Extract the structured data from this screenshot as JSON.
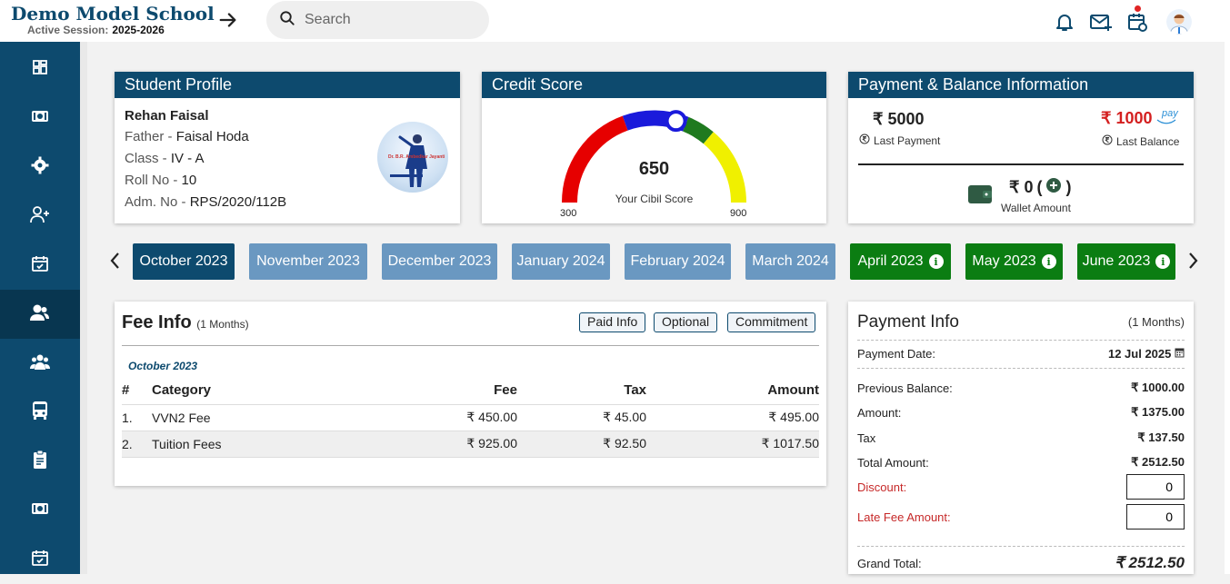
{
  "header": {
    "school_name": "Demo Model School",
    "session_label": "Active Session:",
    "session_value": "2025-2026",
    "search_placeholder": "Search"
  },
  "sidebar": {
    "items": [
      {
        "icon": "dashboard-icon"
      },
      {
        "icon": "money-icon"
      },
      {
        "icon": "settings-icon"
      },
      {
        "icon": "add-user-icon"
      },
      {
        "icon": "calendar-check-icon"
      },
      {
        "icon": "users-icon",
        "active": true
      },
      {
        "icon": "group-icon"
      },
      {
        "icon": "bus-icon"
      },
      {
        "icon": "clipboard-icon"
      },
      {
        "icon": "money-icon"
      },
      {
        "icon": "calendar-icon"
      }
    ]
  },
  "profile": {
    "title": "Student Profile",
    "name": "Rehan Faisal",
    "father_label": "Father - ",
    "father": "Faisal Hoda",
    "class_label": "Class - ",
    "class": "IV - A",
    "roll_label": "Roll No - ",
    "roll": "10",
    "adm_label": "Adm. No - ",
    "adm": "RPS/2020/112B",
    "photo_text": "Dr. B.R. Ambedkar Jayanti"
  },
  "credit": {
    "title": "Credit Score",
    "score": "650",
    "score_label": "Your Cibil Score",
    "min": "300",
    "max": "900",
    "score_value": 650,
    "range": [
      300,
      900
    ],
    "segment_colors": [
      "#e60000",
      "#1a1adb",
      "#1f7a1f",
      "#f0f000"
    ]
  },
  "payment_balance": {
    "title": "Payment & Balance Information",
    "last_payment": "₹ 5000",
    "last_payment_label": "Last Payment",
    "last_balance": "₹ 1000",
    "last_balance_label": "Last Balance",
    "pay_logo": "pay",
    "wallet_amount": "₹ 0",
    "wallet_label": "Wallet Amount"
  },
  "months": [
    {
      "label": "October 2023",
      "state": "selected"
    },
    {
      "label": "November 2023",
      "state": "unpaid"
    },
    {
      "label": "December 2023",
      "state": "unpaid"
    },
    {
      "label": "January 2024",
      "state": "unpaid"
    },
    {
      "label": "February 2024",
      "state": "unpaid"
    },
    {
      "label": "March 2024",
      "state": "unpaid"
    },
    {
      "label": "April 2023",
      "state": "paid"
    },
    {
      "label": "May 2023",
      "state": "paid"
    },
    {
      "label": "June 2023",
      "state": "paid"
    }
  ],
  "fee_info": {
    "title": "Fee Info",
    "months_note": "(1 Months)",
    "buttons": {
      "paid": "Paid Info",
      "optional": "Optional",
      "commitment": "Commitment"
    },
    "month_label": "October 2023",
    "columns": [
      "#",
      "Category",
      "Fee",
      "Tax",
      "Amount"
    ],
    "rows": [
      [
        "1.",
        "VVN2 Fee",
        "₹ 450.00",
        "₹ 45.00",
        "₹ 495.00"
      ],
      [
        "2.",
        "Tuition Fees",
        "₹ 925.00",
        "₹ 92.50",
        "₹ 1017.50"
      ]
    ]
  },
  "payment_info": {
    "title": "Payment Info",
    "months_note": "(1 Months)",
    "date_label": "Payment Date:",
    "date_value": "12 Jul 2025",
    "prev_balance_label": "Previous Balance:",
    "prev_balance": "₹ 1000.00",
    "amount_label": "Amount:",
    "amount": "₹ 1375.00",
    "tax_label": "Tax",
    "tax": "₹ 137.50",
    "total_label": "Total Amount:",
    "total": "₹ 2512.50",
    "discount_label": "Discount:",
    "discount": "0",
    "late_fee_label": "Late Fee Amount:",
    "late_fee": "0",
    "grand_label": "Grand Total:",
    "grand": "₹ 2512.50"
  }
}
